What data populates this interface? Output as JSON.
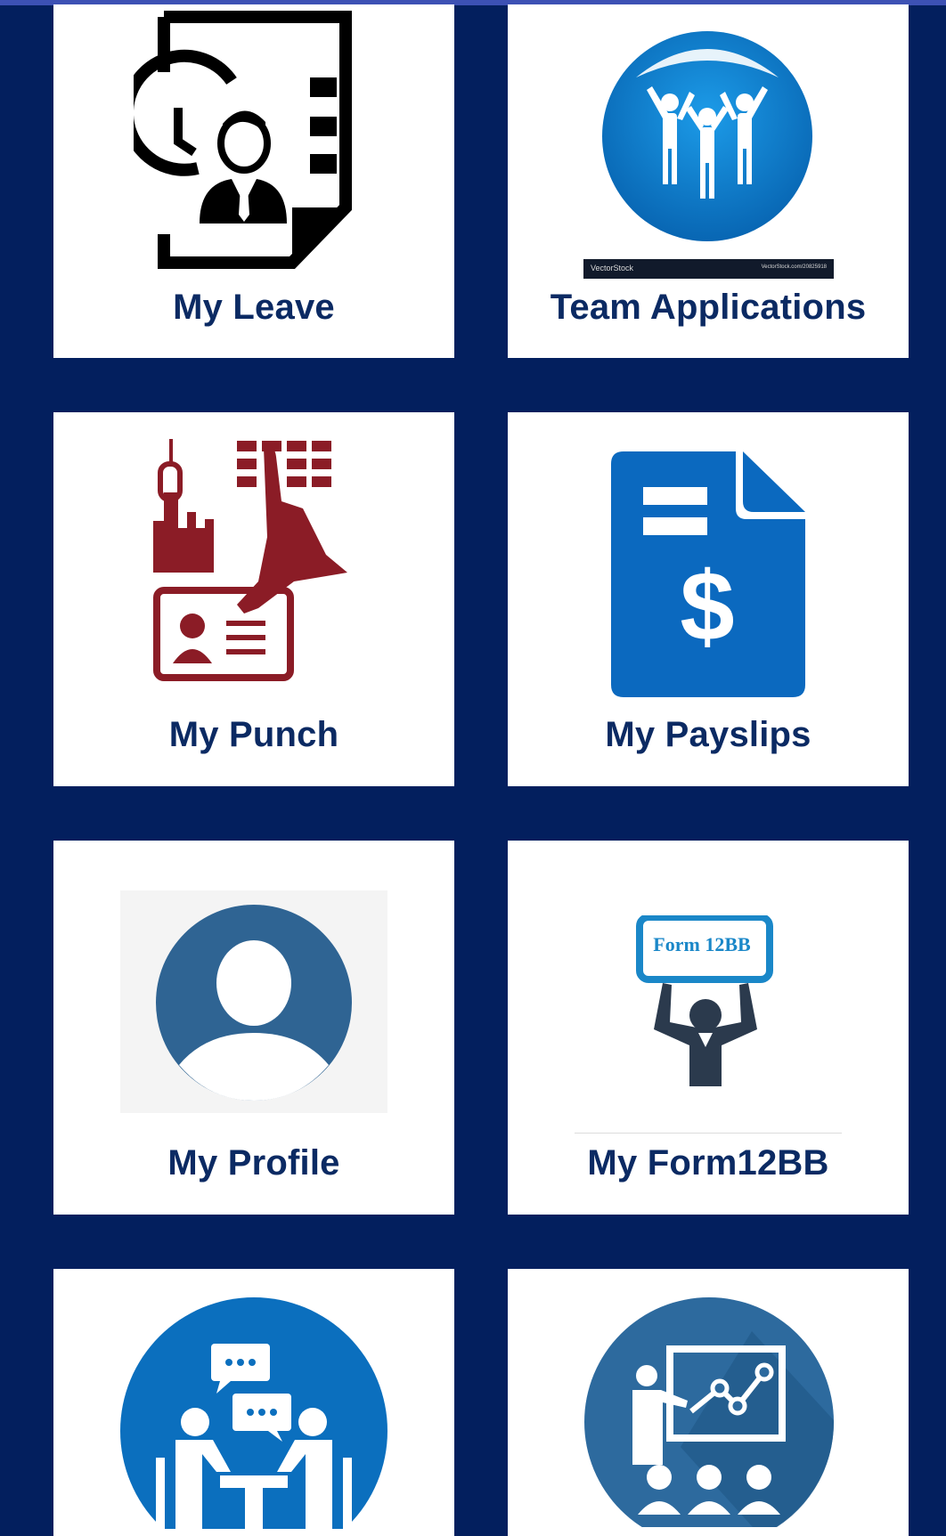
{
  "tiles": [
    {
      "label": "My Leave"
    },
    {
      "label": "Team Applications",
      "watermark": "VectorStock",
      "watermark_url": "VectorStock.com/20825918"
    },
    {
      "label": "My Punch"
    },
    {
      "label": "My Payslips"
    },
    {
      "label": "My Profile"
    },
    {
      "label": "My Form12BB",
      "sign_text": "Form 12BB"
    },
    {
      "label": ""
    },
    {
      "label": ""
    }
  ],
  "colors": {
    "background": "#031f5e",
    "top_bar": "#3d51b4",
    "tile": "#ffffff",
    "label": "#0b2a63",
    "team_blue": "#0a7ac9",
    "punch_red": "#8b1c26",
    "payslip_blue": "#0b69bf",
    "profile_blue": "#2f6493",
    "form_dark": "#2b3a4d",
    "form_sign": "#1a87c8"
  },
  "icons": [
    "leave-document-icon",
    "team-cheer-icon",
    "punch-biometric-icon",
    "payslip-dollar-icon",
    "profile-avatar-icon",
    "form12bb-person-icon",
    "meeting-people-icon",
    "presentation-chart-icon"
  ]
}
